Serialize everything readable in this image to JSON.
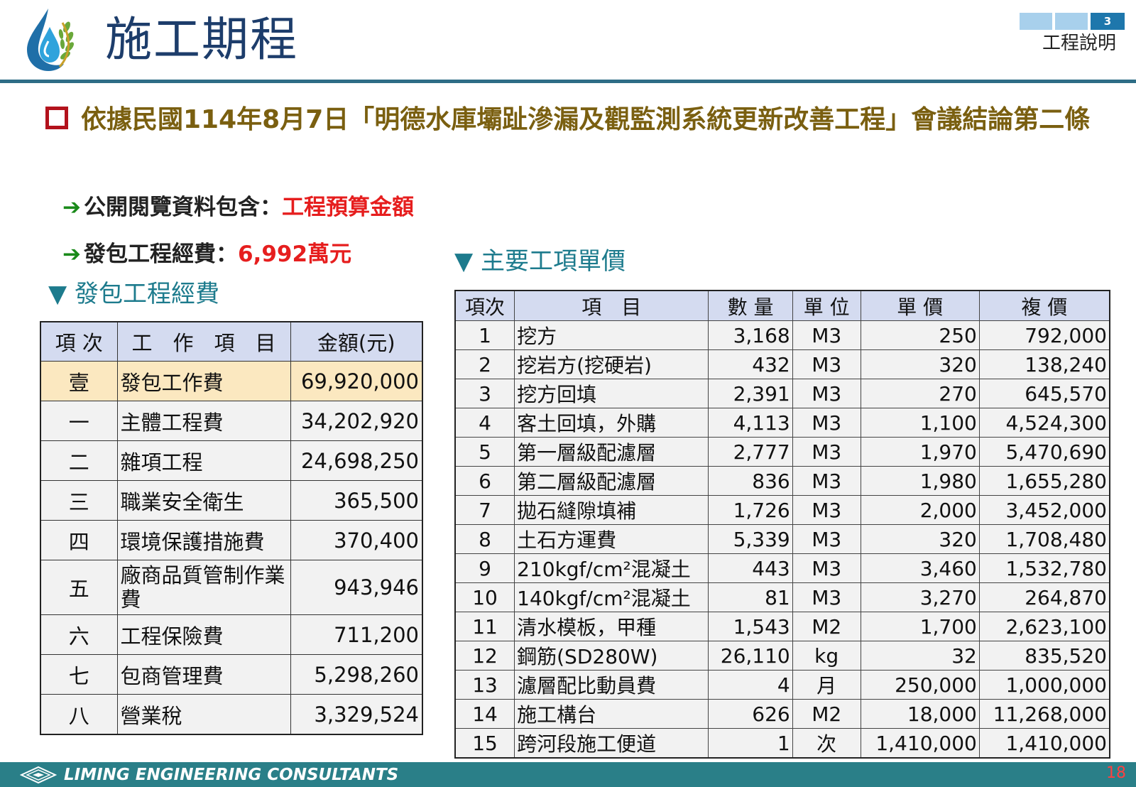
{
  "header": {
    "title": "施工期程",
    "section_number": "3",
    "section_label": "工程說明"
  },
  "main_heading": "依據民國114年8月7日「明德水庫壩趾滲漏及觀監測系統更新改善工程」會議結論第二條",
  "bullets": [
    {
      "label": "公開閱覽資料包含：",
      "value": "工程預算金額"
    },
    {
      "label": "發包工程經費：",
      "value": "6,992萬元"
    }
  ],
  "budget_table": {
    "subtitle": "▼ 發包工程經費",
    "headers": [
      "項 次",
      "工　作　項　目",
      "金額(元)"
    ],
    "rows": [
      {
        "no": "壹",
        "item": "發包工作費",
        "amount": "69,920,000"
      },
      {
        "no": "一",
        "item": "主體工程費",
        "amount": "34,202,920"
      },
      {
        "no": "二",
        "item": "雜項工程",
        "amount": "24,698,250"
      },
      {
        "no": "三",
        "item": "職業安全衛生",
        "amount": "365,500"
      },
      {
        "no": "四",
        "item": "環境保護措施費",
        "amount": "370,400"
      },
      {
        "no": "五",
        "item": "廠商品質管制作業費",
        "amount": "943,946"
      },
      {
        "no": "六",
        "item": "工程保險費",
        "amount": "711,200"
      },
      {
        "no": "七",
        "item": "包商管理費",
        "amount": "5,298,260"
      },
      {
        "no": "八",
        "item": "營業稅",
        "amount": "3,329,524"
      }
    ]
  },
  "items_table": {
    "subtitle": "▼ 主要工項單價",
    "headers": [
      "項次",
      "項　目",
      "數 量",
      "單 位",
      "單 價",
      "複 價"
    ],
    "rows": [
      {
        "no": "1",
        "item": "挖方",
        "qty": "3,168",
        "unit": "M3",
        "price": "250",
        "total": "792,000"
      },
      {
        "no": "2",
        "item": "挖岩方(挖硬岩)",
        "qty": "432",
        "unit": "M3",
        "price": "320",
        "total": "138,240"
      },
      {
        "no": "3",
        "item": "挖方回填",
        "qty": "2,391",
        "unit": "M3",
        "price": "270",
        "total": "645,570"
      },
      {
        "no": "4",
        "item": "客土回填，外購",
        "qty": "4,113",
        "unit": "M3",
        "price": "1,100",
        "total": "4,524,300"
      },
      {
        "no": "5",
        "item": "第一層級配濾層",
        "qty": "2,777",
        "unit": "M3",
        "price": "1,970",
        "total": "5,470,690"
      },
      {
        "no": "6",
        "item": "第二層級配濾層",
        "qty": "836",
        "unit": "M3",
        "price": "1,980",
        "total": "1,655,280"
      },
      {
        "no": "7",
        "item": "拋石縫隙填補",
        "qty": "1,726",
        "unit": "M3",
        "price": "2,000",
        "total": "3,452,000"
      },
      {
        "no": "8",
        "item": "土石方運費",
        "qty": "5,339",
        "unit": "M3",
        "price": "320",
        "total": "1,708,480"
      },
      {
        "no": "9",
        "item": "210kgf/cm²混凝土",
        "qty": "443",
        "unit": "M3",
        "price": "3,460",
        "total": "1,532,780"
      },
      {
        "no": "10",
        "item": "140kgf/cm²混凝土",
        "qty": "81",
        "unit": "M3",
        "price": "3,270",
        "total": "264,870"
      },
      {
        "no": "11",
        "item": "清水模板，甲種",
        "qty": "1,543",
        "unit": "M2",
        "price": "1,700",
        "total": "2,623,100"
      },
      {
        "no": "12",
        "item": "鋼筋(SD280W)",
        "qty": "26,110",
        "unit": "kg",
        "price": "32",
        "total": "835,520"
      },
      {
        "no": "13",
        "item": "濾層配比動員費",
        "qty": "4",
        "unit": "月",
        "price": "250,000",
        "total": "1,000,000"
      },
      {
        "no": "14",
        "item": "施工構台",
        "qty": "626",
        "unit": "M2",
        "price": "18,000",
        "total": "11,268,000"
      },
      {
        "no": "15",
        "item": "跨河段施工便道",
        "qty": "1",
        "unit": "次",
        "price": "1,410,000",
        "total": "1,410,000"
      }
    ]
  },
  "footer": {
    "company": "LIMING ENGINEERING CONSULTANTS",
    "page_number": "18"
  },
  "colors": {
    "title": "#1d3d6b",
    "heading": "#7a5f10",
    "accent_red": "#e61e1e",
    "subtitle": "#1d7b8d",
    "footer": "#2a7f88"
  }
}
